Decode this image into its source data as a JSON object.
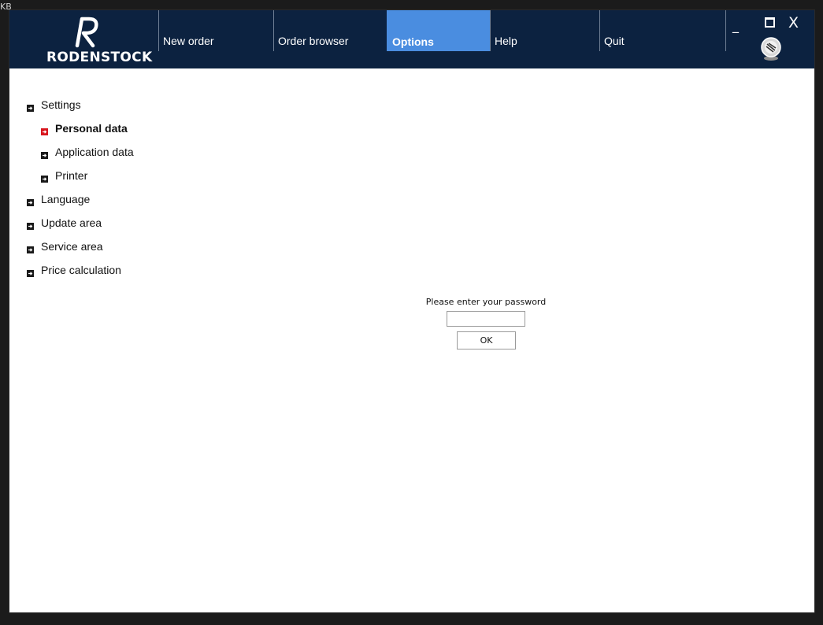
{
  "corner_text": "KB",
  "app": {
    "logo_text": "RODENSTOCK"
  },
  "nav": {
    "items": [
      {
        "label": "New order",
        "active": false
      },
      {
        "label": "Order browser",
        "active": false
      },
      {
        "label": "Options",
        "active": true
      },
      {
        "label": "Help",
        "active": false
      },
      {
        "label": "Quit",
        "active": false
      }
    ]
  },
  "window_controls": {
    "minimize_label": "_",
    "close_label": "X",
    "icons": [
      "minimize-icon",
      "maximize-icon",
      "close-icon",
      "support-icon"
    ]
  },
  "tree": {
    "items": [
      {
        "label": "Settings",
        "level": 0,
        "selected": false
      },
      {
        "label": "Personal data",
        "level": 1,
        "selected": true
      },
      {
        "label": "Application data",
        "level": 1,
        "selected": false
      },
      {
        "label": "Printer",
        "level": 1,
        "selected": false
      },
      {
        "label": "Language",
        "level": 0,
        "selected": false
      },
      {
        "label": "Update area",
        "level": 0,
        "selected": false
      },
      {
        "label": "Service area",
        "level": 0,
        "selected": false
      },
      {
        "label": "Price calculation",
        "level": 0,
        "selected": false
      }
    ]
  },
  "password": {
    "label": "Please enter your password",
    "value": "",
    "placeholder": "",
    "ok_label": "OK"
  },
  "colors": {
    "header_bg": "#0c2240",
    "active_tab": "#4a8de0",
    "tree_expander": "#1a1a1a",
    "tree_expander_selected": "#d8161e"
  }
}
